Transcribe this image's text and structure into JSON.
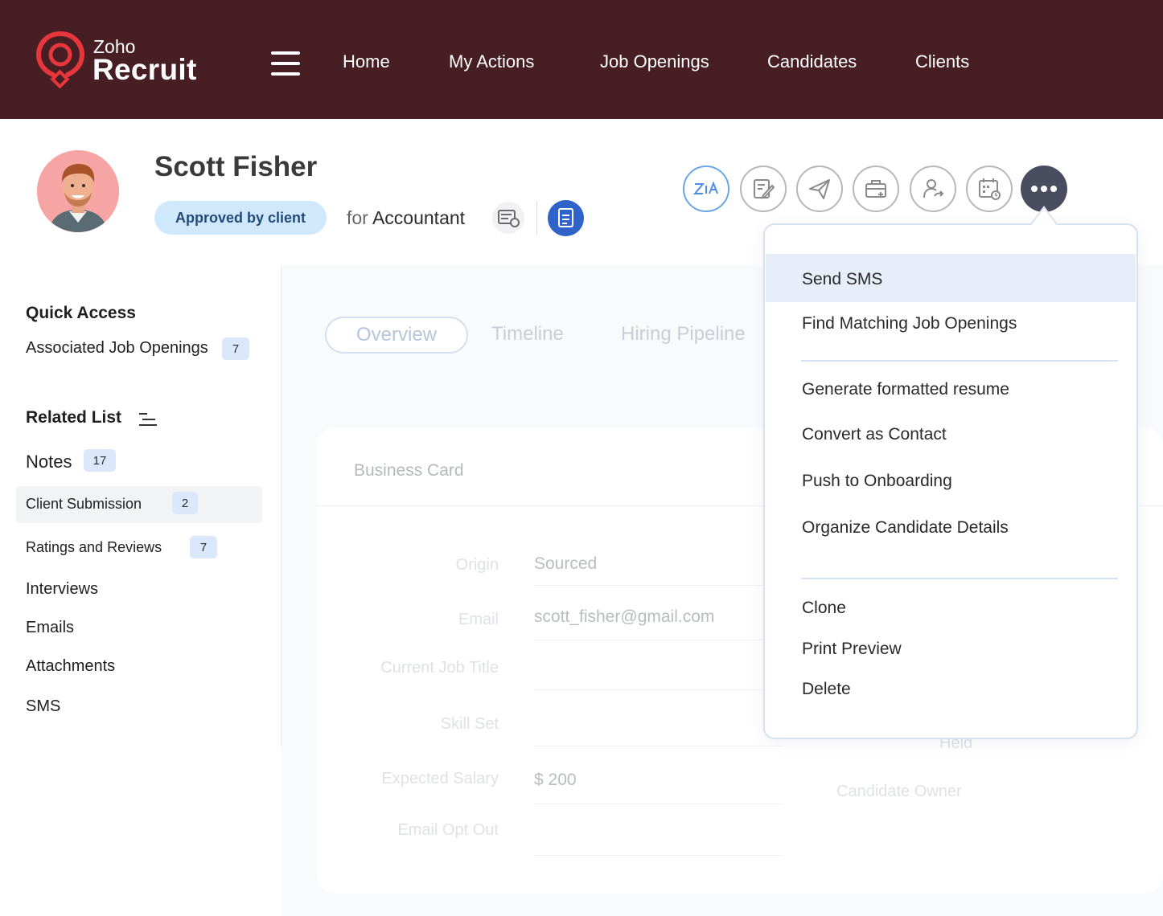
{
  "app": {
    "brand_small": "Zoho",
    "brand_big": "Recruit",
    "brand_color": "#e8363d",
    "topbar_color": "#461e23"
  },
  "nav": {
    "items": [
      "Home",
      "My Actions",
      "Job Openings",
      "Candidates",
      "Clients"
    ]
  },
  "candidate": {
    "name": "Scott Fisher",
    "status": "Approved by client",
    "for_prefix": "for",
    "job_title": "Accountant"
  },
  "actions": {
    "icons": [
      "zia-icon",
      "edit-icon",
      "send-icon",
      "briefcase-add-icon",
      "assign-user-icon",
      "calendar-schedule-icon",
      "more-icon"
    ]
  },
  "left_panel": {
    "quick_access_title": "Quick Access",
    "quick_access_items": [
      {
        "label": "Associated Job Openings",
        "count": "7"
      }
    ],
    "related_list_title": "Related List",
    "related_items": [
      {
        "label": "Notes",
        "count": "17"
      },
      {
        "label": "Client Submission",
        "count": "2"
      },
      {
        "label": "Ratings and Reviews",
        "count": "7"
      },
      {
        "label": "Interviews"
      },
      {
        "label": "Emails"
      },
      {
        "label": "Attachments"
      },
      {
        "label": "SMS"
      }
    ]
  },
  "tabs": [
    "Overview",
    "Timeline",
    "Hiring Pipeline"
  ],
  "card": {
    "title": "Business Card",
    "fields": [
      {
        "label": "Origin",
        "value": "Sourced"
      },
      {
        "label": "Email",
        "value": "scott_fisher@gmail.com"
      },
      {
        "label": "Current Job Title",
        "value": ""
      },
      {
        "label": "Skill Set",
        "value": ""
      },
      {
        "label": "Expected Salary",
        "value": "$ 200"
      },
      {
        "label": "Email Opt Out",
        "value": ""
      }
    ],
    "right_labels": [
      "Held",
      "Candidate Owner"
    ]
  },
  "dropdown": {
    "group1": [
      "Send SMS",
      "Find Matching Job Openings"
    ],
    "group2": [
      "Generate formatted resume",
      "Convert as Contact",
      "Push to Onboarding",
      "Organize Candidate Details"
    ],
    "group3": [
      "Clone",
      "Print Preview",
      "Delete"
    ],
    "highlight_color": "#e7eef9"
  }
}
